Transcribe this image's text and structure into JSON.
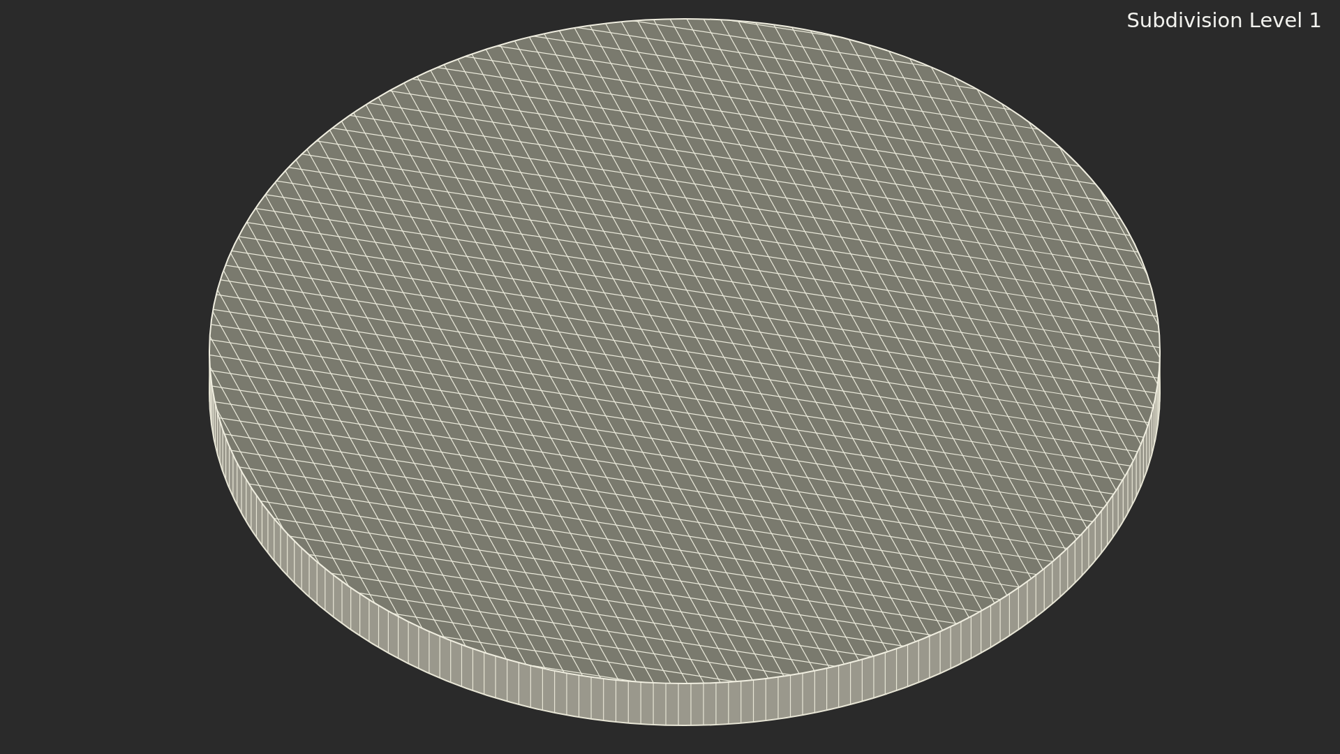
{
  "viewport": {
    "label": "Subdivision Level 1"
  }
}
